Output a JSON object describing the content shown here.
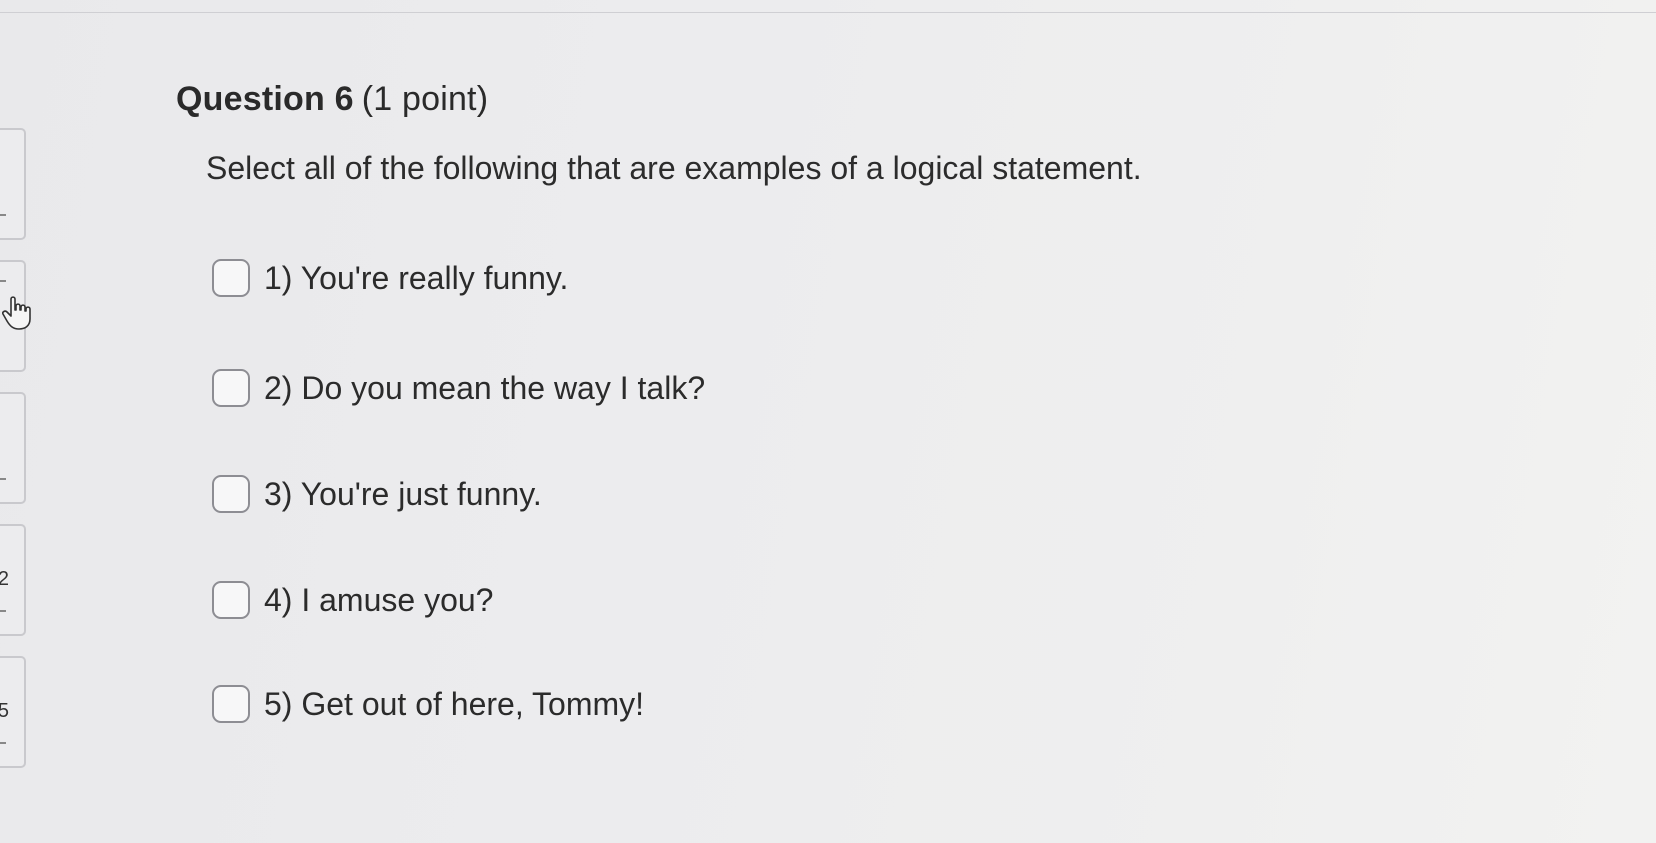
{
  "question": {
    "label": "Question 6",
    "points": "(1 point)",
    "prompt": "Select all of the following that are examples of a logical statement."
  },
  "options": [
    {
      "text": "1) You're really funny.",
      "checked": false
    },
    {
      "text": "2) Do you mean the way I talk?",
      "checked": false
    },
    {
      "text": "3) You're just funny.",
      "checked": false
    },
    {
      "text": "4) I amuse you?",
      "checked": false
    },
    {
      "text": "5) Get out of here, Tommy!",
      "checked": false
    }
  ],
  "side_nav": {
    "visible_numbers": [
      "2",
      "5"
    ]
  },
  "colors": {
    "background": "#ececee",
    "text": "#2b2b2b",
    "checkbox_border": "#8d8d93"
  }
}
